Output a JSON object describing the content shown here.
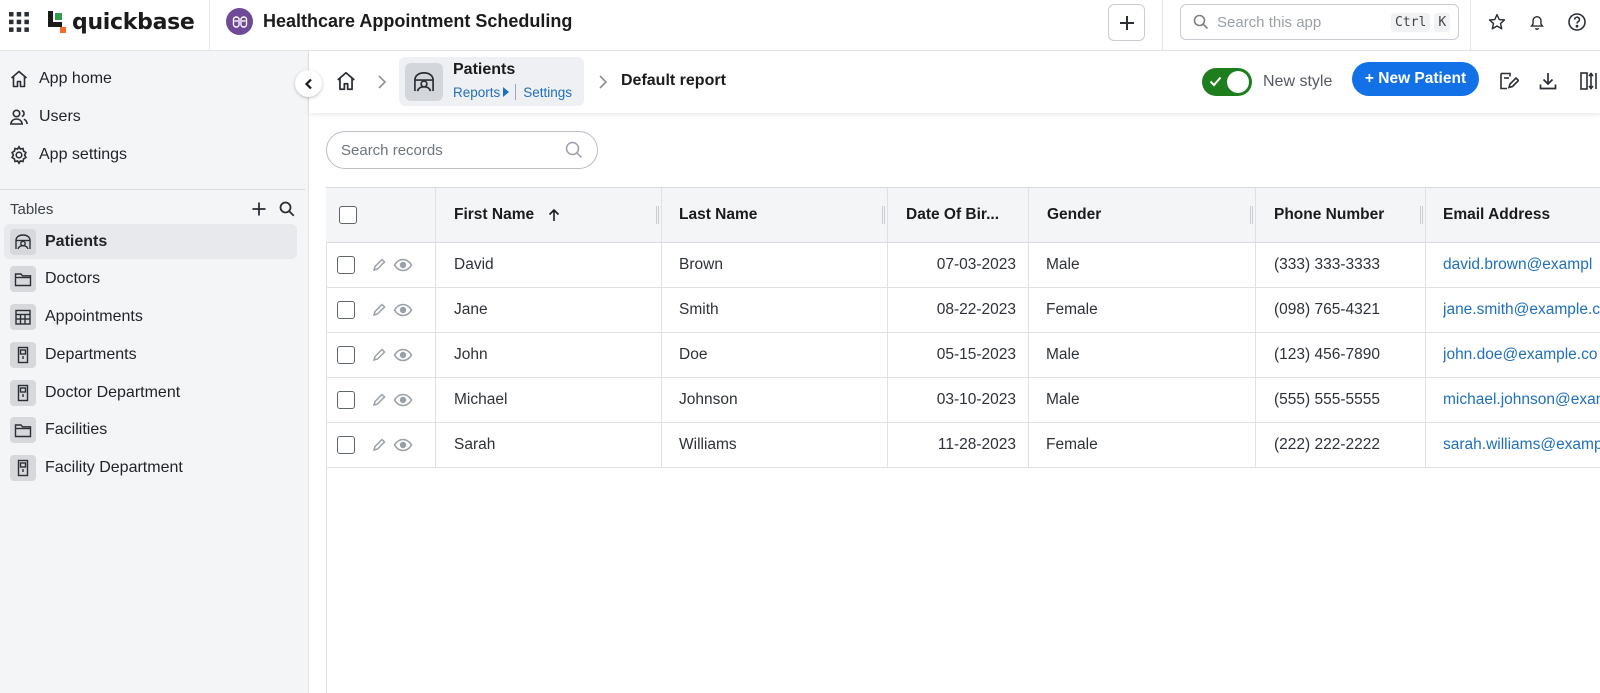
{
  "topbar": {
    "brand": "quickbase",
    "app_title": "Healthcare Appointment Scheduling",
    "search_placeholder": "Search this app",
    "shortcut_key1": "Ctrl",
    "shortcut_key2": "K",
    "icons": [
      "apps-grid-icon",
      "plus-icon",
      "search-icon",
      "star-icon",
      "bell-icon",
      "help-icon"
    ]
  },
  "sidebar": {
    "nav": [
      {
        "label": "App home",
        "icon": "home-icon"
      },
      {
        "label": "Users",
        "icon": "users-icon"
      },
      {
        "label": "App settings",
        "icon": "gear-icon"
      }
    ],
    "tables_label": "Tables",
    "tables": [
      {
        "label": "Patients",
        "icon": "patient-icon",
        "active": true
      },
      {
        "label": "Doctors",
        "icon": "folder-icon"
      },
      {
        "label": "Appointments",
        "icon": "calendar-icon"
      },
      {
        "label": "Departments",
        "icon": "door-icon"
      },
      {
        "label": "Doctor Department",
        "icon": "door-icon"
      },
      {
        "label": "Facilities",
        "icon": "folder-icon"
      },
      {
        "label": "Facility Department",
        "icon": "door-icon"
      }
    ]
  },
  "header": {
    "table_name": "Patients",
    "reports_link": "Reports",
    "settings_link": "Settings",
    "report_name": "Default report",
    "toggle_label": "New style",
    "toggle_on": true,
    "new_button": "+ New Patient",
    "accent_color": "#1271e6",
    "toggle_color": "#1e7e1e"
  },
  "records": {
    "search_placeholder": "Search records",
    "columns": [
      "First Name",
      "Last Name",
      "Date Of Bir...",
      "Gender",
      "Phone Number",
      "Email Address"
    ],
    "sort_column": "First Name",
    "sort_direction": "ascending",
    "rows": [
      {
        "first": "David",
        "last": "Brown",
        "dob": "07-03-2023",
        "gender": "Male",
        "phone": "(333) 333-3333",
        "email": "david.brown@exampl"
      },
      {
        "first": "Jane",
        "last": "Smith",
        "dob": "08-22-2023",
        "gender": "Female",
        "phone": "(098) 765-4321",
        "email": "jane.smith@example.c"
      },
      {
        "first": "John",
        "last": "Doe",
        "dob": "05-15-2023",
        "gender": "Male",
        "phone": "(123) 456-7890",
        "email": "john.doe@example.co"
      },
      {
        "first": "Michael",
        "last": "Johnson",
        "dob": "03-10-2023",
        "gender": "Male",
        "phone": "(555) 555-5555",
        "email": "michael.johnson@exan"
      },
      {
        "first": "Sarah",
        "last": "Williams",
        "dob": "11-28-2023",
        "gender": "Female",
        "phone": "(222) 222-2222",
        "email": "sarah.williams@examp"
      }
    ]
  }
}
